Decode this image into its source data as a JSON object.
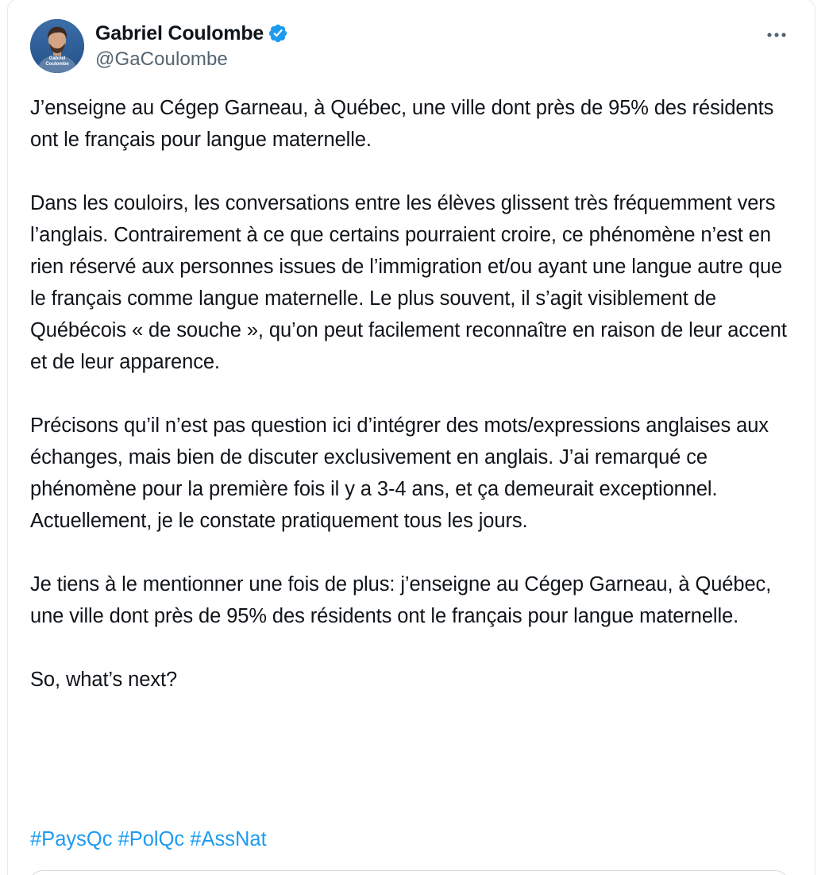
{
  "author": {
    "display_name": "Gabriel Coulombe",
    "handle": "@GaCoulombe",
    "verified": true,
    "avatar_caption_line1": "Gabriel",
    "avatar_caption_line2": "Coulombe"
  },
  "icons": {
    "verified": "verified-badge-icon",
    "more": "more-options-icon"
  },
  "colors": {
    "text": "#0f1419",
    "secondary_text": "#536471",
    "link": "#1d9bf0",
    "verified": "#1d9bf0"
  },
  "tweet": {
    "paragraphs": [
      "J’enseigne au Cégep Garneau, à Québec, une ville dont près de 95% des résidents ont le français pour langue maternelle.",
      "Dans les couloirs, les conversations entre les élèves glissent très fréquemment vers l’anglais. Contrairement à ce que certains pourraient croire, ce phénomène n’est en rien réservé aux personnes issues de l’immigration et/ou ayant une langue autre que le français comme langue maternelle. Le plus souvent, il s’agit visiblement de Québécois « de souche », qu’on peut facilement reconnaître en raison de leur accent et de leur apparence.",
      "Précisons qu’il n’est pas question ici d’intégrer des mots/expressions anglaises aux échanges, mais bien de discuter exclusivement en anglais. J’ai remarqué ce phénomène pour la première fois il y a 3-4 ans, et ça demeurait exceptionnel. Actuellement, je le constate pratiquement tous les jours.",
      "Je tiens à le mentionner une fois de plus: j’enseigne au Cégep Garneau, à Québec, une ville dont près de 95% des résidents ont le français pour langue maternelle.",
      "So, what’s next?"
    ],
    "hashtags": [
      "#PaysQc",
      "#PolQc",
      "#AssNat"
    ]
  }
}
